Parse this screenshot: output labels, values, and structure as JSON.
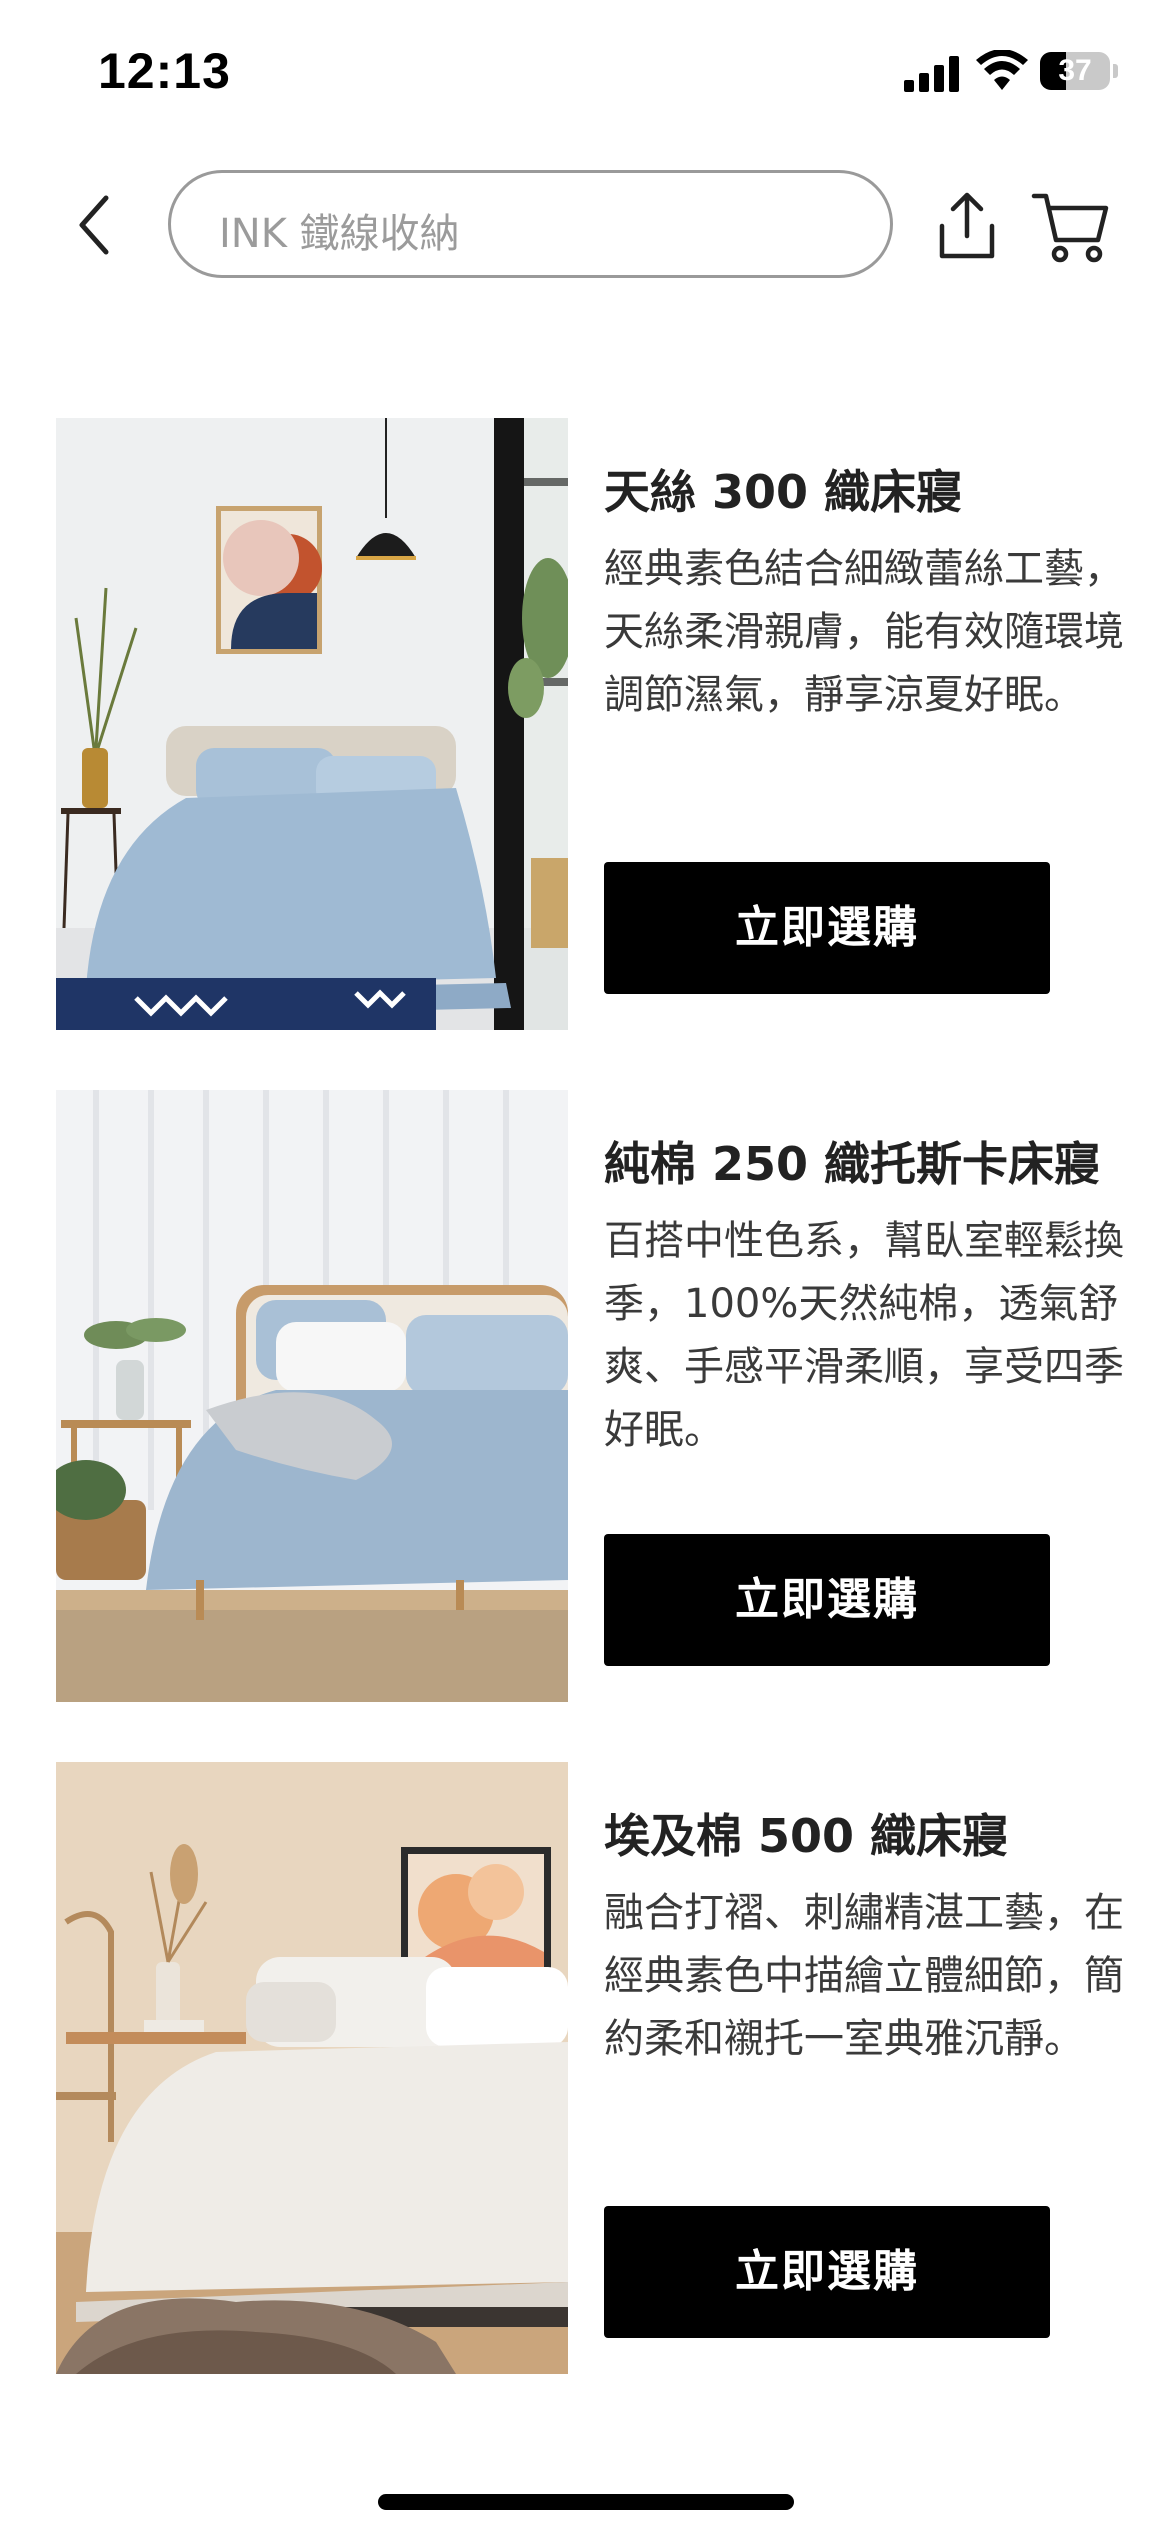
{
  "status_bar": {
    "time": "12:13",
    "battery": "37",
    "battery_level": 0.37
  },
  "search": {
    "text": "INK 鐵線收納"
  },
  "icons": {
    "back": "chevron-left-icon",
    "share": "share-icon",
    "cart": "cart-icon"
  },
  "colors": {
    "button_bg": "#000000",
    "button_text": "#ffffff",
    "search_border": "#9a9a9a",
    "placeholder": "#9b9b9b"
  },
  "products": [
    {
      "title": "天絲 300 織床寢",
      "description": "經典素色結合細緻蕾絲工藝，天絲柔滑親膚，能有效隨環境調節濕氣，靜享涼夏好眠。",
      "button_label": "立即選購",
      "image_desc": "light blue bedding in bright bedroom"
    },
    {
      "title": "純棉 250 織托斯卡床寢",
      "description": "百搭中性色系，幫臥室輕鬆換季，100%天然純棉，透氣舒爽、手感平滑柔順，享受四季好眠。",
      "button_label": "立即選購",
      "image_desc": "blue bedding with grey throw"
    },
    {
      "title": "埃及棉 500 織床寢",
      "description": "融合打褶、刺繡精湛工藝，在經典素色中描繪立體細節，簡約柔和襯托一室典雅沉靜。",
      "button_label": "立即選購",
      "image_desc": "white bedding in warm beige room"
    }
  ]
}
